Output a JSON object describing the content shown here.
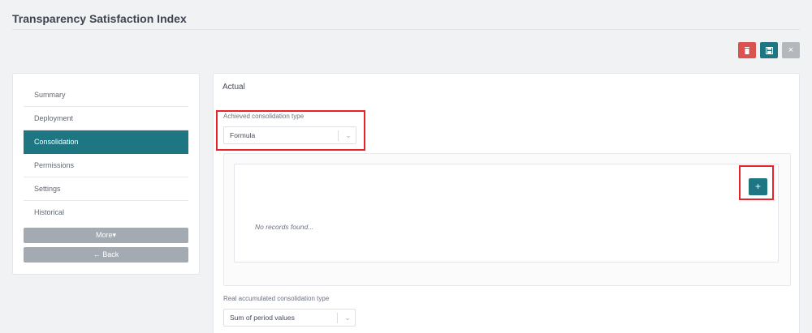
{
  "page": {
    "title": "Transparency Satisfaction Index"
  },
  "toolbar": {
    "delete_icon": "trash-icon",
    "save_icon": "save-icon",
    "close_icon": "close-icon",
    "close_glyph": "×",
    "colors": {
      "delete": "#d9534f",
      "save": "#1f7683",
      "close": "#b4b8bd"
    }
  },
  "sidebar": {
    "items": [
      {
        "label": "Summary",
        "active": false
      },
      {
        "label": "Deployment",
        "active": false
      },
      {
        "label": "Consolidation",
        "active": true
      },
      {
        "label": "Permissions",
        "active": false
      },
      {
        "label": "Settings",
        "active": false
      },
      {
        "label": "Historical",
        "active": false
      }
    ],
    "more_label": "More▾",
    "back_label": "← Back"
  },
  "main": {
    "section_title": "Actual",
    "achieved": {
      "label": "Achieved consolidation type",
      "value": "Formula"
    },
    "formula_panel": {
      "empty_text": "No records found...",
      "add_label": "+"
    },
    "real_accumulated": {
      "label": "Real accumulated consolidation type",
      "value": "Sum of period values"
    }
  },
  "colors": {
    "accent": "#1f7683",
    "highlight": "#e8232a"
  }
}
